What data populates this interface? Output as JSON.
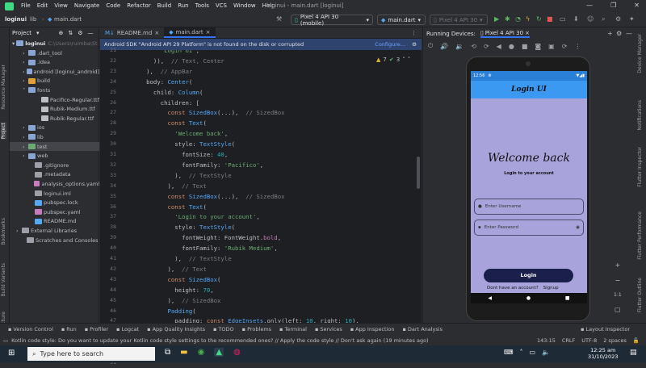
{
  "window": {
    "title": "loginui - main.dart [loginui]",
    "menus": [
      "File",
      "Edit",
      "View",
      "Navigate",
      "Code",
      "Refactor",
      "Build",
      "Run",
      "Tools",
      "VCS",
      "Window",
      "Help"
    ]
  },
  "toolbar": {
    "breadcrumb": [
      "loginui",
      "lib",
      "main.dart"
    ],
    "device": "Pixel 4 API 30 (mobile)",
    "config": "main.dart",
    "avd": "Pixel 4 API 30"
  },
  "project": {
    "label": "Project",
    "root": "loginui",
    "root_path": "C:\\Users\\ruimba\\St",
    "items": [
      ".dart_tool",
      ".idea",
      "android [loginui_android]",
      "build",
      "fonts",
      "Pacifico-Regular.ttf",
      "Rubik-Medium.ttf",
      "Rubik-Regular.ttf",
      "ios",
      "lib",
      "test",
      "web",
      ".gitignore",
      ".metadata",
      "analysis_options.yaml",
      "loginui.iml",
      "pubspec.lock",
      "pubspec.yaml",
      "README.md",
      "External Libraries",
      "Scratches and Consoles"
    ]
  },
  "side": {
    "left_labels": [
      "Resource Manager",
      "Project",
      "Bookmarks",
      "Build Variants",
      "Structure"
    ],
    "right_labels": [
      "Device Manager",
      "Notifications",
      "Flutter Inspector",
      "Flutter Performance",
      "Flutter Outline"
    ]
  },
  "editor": {
    "tabs": [
      "README.md",
      "main.dart"
    ],
    "notice": "Android SDK \"Android API 29 Platform\" is not found on the disk or corrupted",
    "notice_action": "Configure...",
    "warnings": "7",
    "weak": "3",
    "line_numbers": [
      "21",
      "22",
      "23",
      "24",
      "25",
      "26",
      "27",
      "28",
      "29",
      "30",
      "31",
      "32",
      "33",
      "34",
      "35",
      "36",
      "37",
      "38",
      "39",
      "40",
      "41",
      "42",
      "43",
      "44",
      "45",
      "46",
      "47",
      "48",
      "49",
      "50",
      "51"
    ]
  },
  "device": {
    "label": "Running Devices:",
    "tab": "Pixel 4 API 30"
  },
  "phone": {
    "time": "12:56",
    "app_title": "Login UI",
    "welcome": "Welcome back",
    "subtitle": "Login to your account",
    "username_placeholder": "Enter Username",
    "password_placeholder": "Enter Password",
    "login_button": "Login",
    "no_account": "Dont have an account?",
    "signup": "Signup"
  },
  "zoom": "1:1",
  "toolwindows": [
    "Version Control",
    "Run",
    "Profiler",
    "Logcat",
    "App Quality Insights",
    "TODO",
    "Problems",
    "Terminal",
    "Services",
    "App Inspection",
    "Dart Analysis",
    "Layout Inspector"
  ],
  "statusbar": {
    "message": "Kotlin code style: Do you want to update your Kotlin code style settings to the recommended ones? // Apply the code style // Don't ask again (19 minutes ago)",
    "position": "143:15",
    "line_sep": "CRLF",
    "encoding": "UTF-8",
    "indent": "2 spaces"
  },
  "taskbar": {
    "search": "Type here to search",
    "time": "12:25 am",
    "date": "31/10/2023"
  }
}
